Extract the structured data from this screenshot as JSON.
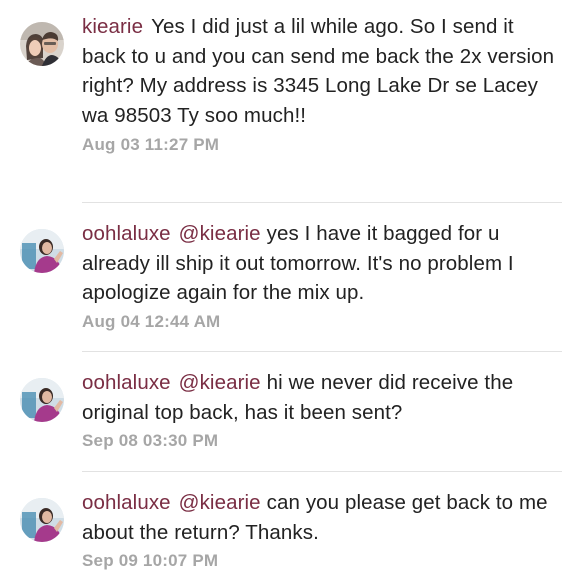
{
  "comments": [
    {
      "user": "kiearie",
      "avatar_icon": "couple-avatar-icon",
      "mention": "",
      "text": "Yes I did just a lil while ago. So I send it back to u and you can send me back the 2x version right? My address is 3345 Long Lake Dr se Lacey wa 98503 Ty soo much!!",
      "time": "Aug 03 11:27 PM"
    },
    {
      "user": "oohlaluxe",
      "avatar_icon": "woman-avatar-icon",
      "mention": "@kiearie",
      "text": "yes I have it bagged for u already ill ship it out tomorrow.  It's no problem I apologize again for the mix up.",
      "time": "Aug 04 12:44 AM"
    },
    {
      "user": "oohlaluxe",
      "avatar_icon": "woman-avatar-icon",
      "mention": "@kiearie",
      "text": "hi we never did receive the original top back, has it been sent?",
      "time": "Sep 08 03:30 PM"
    },
    {
      "user": "oohlaluxe",
      "avatar_icon": "woman-avatar-icon",
      "mention": "@kiearie",
      "text": "can you please get back to me about the return?  Thanks.",
      "time": "Sep 09 10:07 PM"
    }
  ],
  "colors": {
    "username": "#7a2e44",
    "text": "#222222",
    "timestamp": "#a6a6a6",
    "divider": "#e2e2e2"
  }
}
